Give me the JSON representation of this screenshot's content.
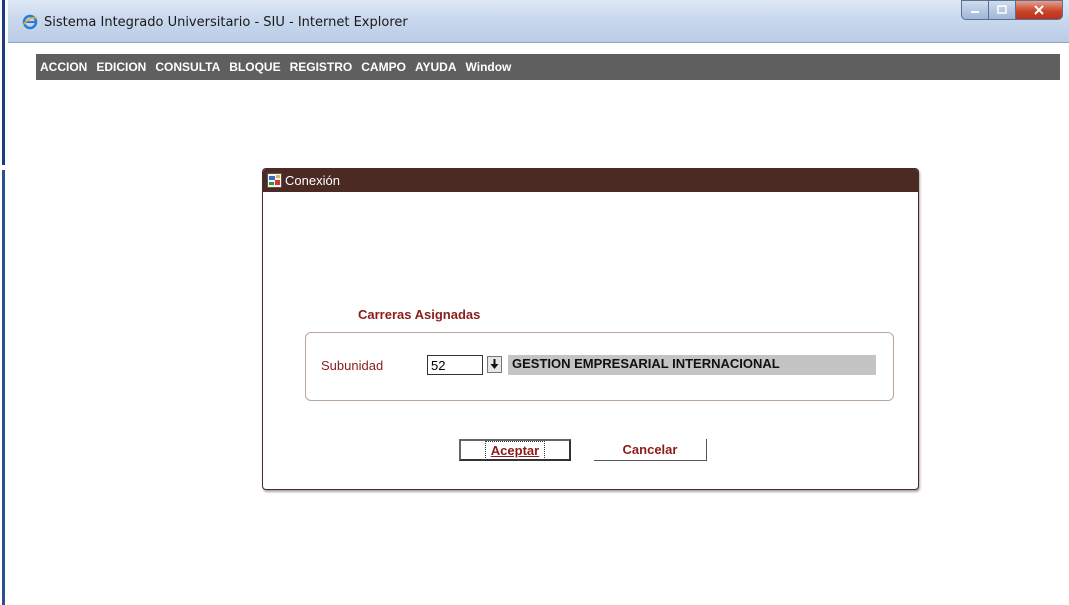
{
  "window": {
    "title": "Sistema Integrado Universitario - SIU - Internet Explorer",
    "buttons": {
      "minimize": "–",
      "maximize": "□",
      "close": "x"
    }
  },
  "menu": {
    "items": [
      "ACCION",
      "EDICION",
      "CONSULTA",
      "BLOQUE",
      "REGISTRO",
      "CAMPO",
      "AYUDA",
      "Window"
    ]
  },
  "dialog": {
    "title": "Conexión",
    "section_label": "Carreras Asignadas",
    "subunidad_label": "Subunidad",
    "subunidad_code": "52",
    "subunidad_description": "GESTION EMPRESARIAL INTERNACIONAL",
    "accept_label": "Aceptar",
    "cancel_label": "Cancelar"
  },
  "colors": {
    "menu_bar": "#5f5f5f",
    "dialog_title_bar": "#4b2a24",
    "label_text": "#8b1c1c",
    "description_field": "#c4c4c4"
  },
  "icons": {
    "browser": "ie-icon",
    "dialog": "form-icon",
    "dropdown": "down-arrow-icon"
  }
}
